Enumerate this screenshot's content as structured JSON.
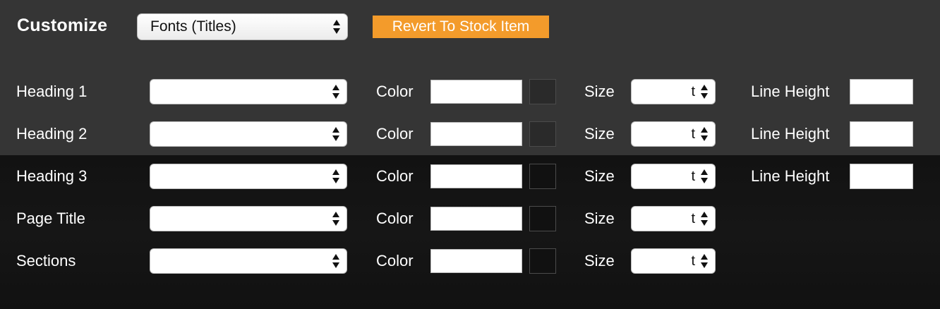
{
  "header": {
    "title": "Customize",
    "preset_select": {
      "selected": "Fonts (Titles)"
    },
    "revert_button": "Revert To Stock Item"
  },
  "labels": {
    "color": "Color",
    "size": "Size",
    "line_height": "Line Height"
  },
  "rows": [
    {
      "label": "Heading 1",
      "size_value": "t"
    },
    {
      "label": "Heading 2",
      "size_value": "t"
    },
    {
      "label": "Heading 3",
      "size_value": "t"
    },
    {
      "label": "Page Title",
      "size_value": "t"
    },
    {
      "label": "Sections",
      "size_value": "t"
    }
  ],
  "colors": {
    "accent": "#f39b2b",
    "panel_top": "#353535",
    "panel_bottom": "#121212"
  },
  "icons": {
    "select_arrows": "up-down-arrows-icon"
  }
}
